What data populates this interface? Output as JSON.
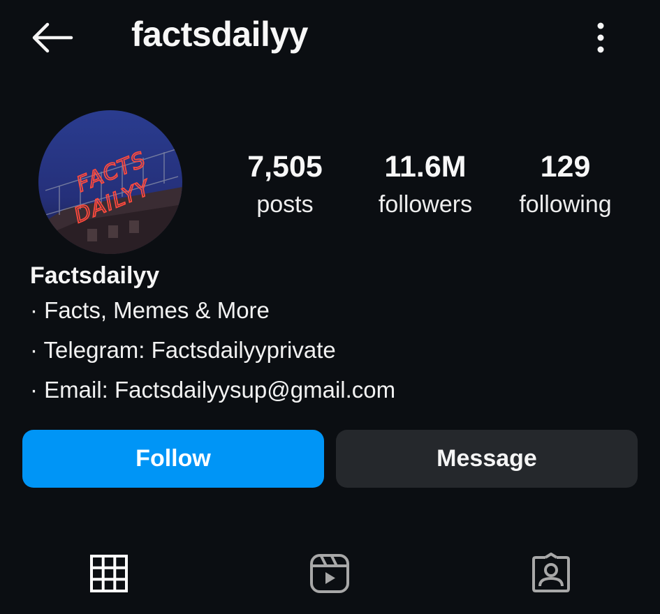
{
  "header": {
    "username": "factsdailyy",
    "back_icon": "arrow-left-icon",
    "more_icon": "more-vertical-icon"
  },
  "profile": {
    "avatar_text_line1": "FACTS",
    "avatar_text_line2": "DAILYY",
    "stats": [
      {
        "value": "7,505",
        "label": "posts"
      },
      {
        "value": "11.6M",
        "label": "followers"
      },
      {
        "value": "129",
        "label": "following"
      }
    ],
    "display_name": "Factsdailyy",
    "bio": [
      "· Facts, Memes & More",
      "· Telegram: Factsdailyyprivate",
      "· Email: Factsdailyysup@gmail.com"
    ]
  },
  "actions": {
    "follow_label": "Follow",
    "message_label": "Message"
  },
  "tabs": [
    {
      "icon": "grid-icon",
      "active": true
    },
    {
      "icon": "reels-icon",
      "active": false
    },
    {
      "icon": "tagged-icon",
      "active": false
    }
  ],
  "colors": {
    "background": "#0b0e12",
    "follow_button": "#0095f6",
    "message_button": "#25282c",
    "neon_sign": "#ff4a3d"
  }
}
